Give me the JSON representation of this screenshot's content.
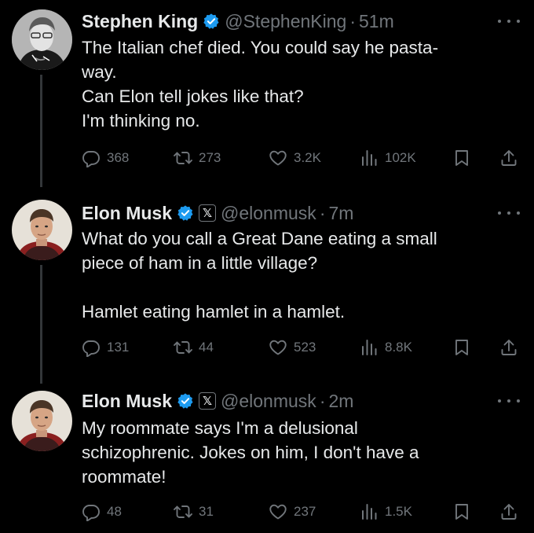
{
  "tweets": [
    {
      "author": "Stephen King",
      "handle": "@StephenKing",
      "separator": "·",
      "time": "51m",
      "lines": [
        "The Italian chef died. You could say he pasta-",
        "way.",
        "Can Elon tell jokes like that?",
        "I'm thinking no."
      ],
      "stats": {
        "replies": "368",
        "reposts": "273",
        "likes": "3.2K",
        "views": "102K"
      }
    },
    {
      "author": "Elon Musk",
      "affiliation": "𝕏",
      "handle": "@elonmusk",
      "separator": "·",
      "time": "7m",
      "lines": [
        "What do you call a Great Dane eating a small",
        "piece of ham in a little village?",
        "",
        "Hamlet eating hamlet in a hamlet."
      ],
      "stats": {
        "replies": "131",
        "reposts": "44",
        "likes": "523",
        "views": "8.8K"
      }
    },
    {
      "author": "Elon Musk",
      "affiliation": "𝕏",
      "handle": "@elonmusk",
      "separator": "·",
      "time": "2m",
      "lines": [
        "My roommate says I'm a delusional",
        "schizophrenic. Jokes on him, I don't have a",
        "roommate!"
      ],
      "stats": {
        "replies": "48",
        "reposts": "31",
        "likes": "237",
        "views": "1.5K"
      }
    }
  ],
  "colors": {
    "background": "#000000",
    "text": "#e7e9ea",
    "muted": "#71767b",
    "verified": "#1d9bf0",
    "thread_line": "#333639"
  },
  "icons": [
    "reply-icon",
    "repost-icon",
    "like-icon",
    "views-icon",
    "bookmark-icon",
    "share-icon",
    "verified-badge-icon",
    "more-icon"
  ]
}
